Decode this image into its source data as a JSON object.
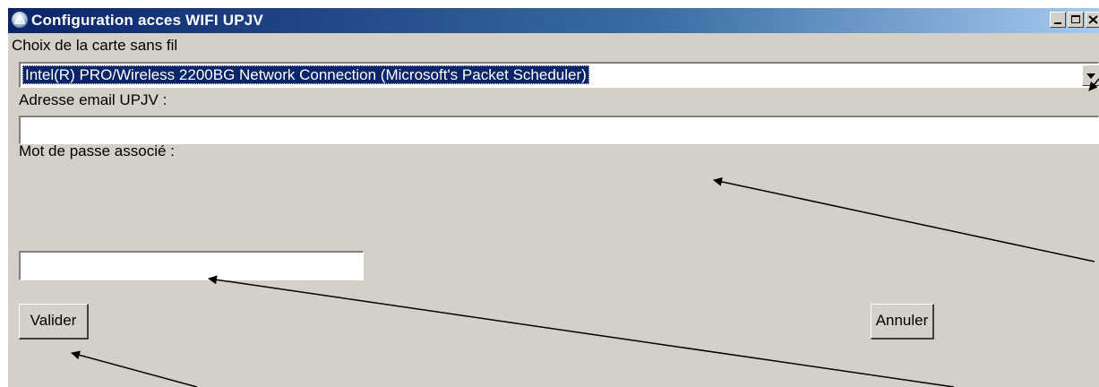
{
  "window": {
    "title": "Configuration acces WIFI UPJV"
  },
  "form": {
    "card_label": "Choix de la carte sans fil",
    "card_selected": "Intel(R) PRO/Wireless 2200BG Network Connection (Microsoft's Packet Scheduler)",
    "email_label": "Adresse email UPJV :",
    "email_value": "",
    "password_label": "Mot de passe associé :",
    "password_value": ""
  },
  "buttons": {
    "validate": "Valider",
    "cancel": "Annuler"
  },
  "colors": {
    "titlebar_start": "#0a246a",
    "titlebar_end": "#a6caf0",
    "window_bg": "#d4d0c8",
    "selection_bg": "#0a246a"
  }
}
